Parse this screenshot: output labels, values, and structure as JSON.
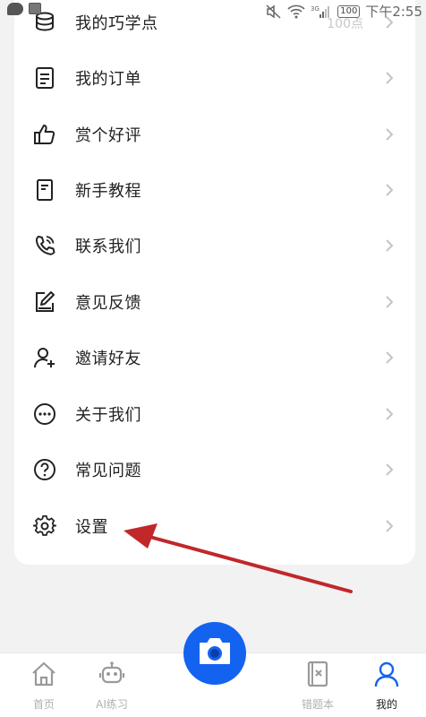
{
  "status_bar": {
    "time": "下午2:55",
    "battery": "100",
    "network": "3G"
  },
  "points": {
    "value": "100点"
  },
  "menu": {
    "items": [
      {
        "label": "我的巧学点",
        "icon": "coins-stack-icon"
      },
      {
        "label": "我的订单",
        "icon": "order-document-icon"
      },
      {
        "label": "赏个好评",
        "icon": "thumbs-up-icon"
      },
      {
        "label": "新手教程",
        "icon": "tutorial-book-icon"
      },
      {
        "label": "联系我们",
        "icon": "phone-icon"
      },
      {
        "label": "意见反馈",
        "icon": "feedback-edit-icon"
      },
      {
        "label": "邀请好友",
        "icon": "add-user-icon"
      },
      {
        "label": "关于我们",
        "icon": "more-dots-icon"
      },
      {
        "label": "常见问题",
        "icon": "question-circle-icon"
      },
      {
        "label": "设置",
        "icon": "gear-icon"
      }
    ]
  },
  "tab_bar": {
    "tabs": [
      {
        "label": "首页",
        "icon": "home-icon"
      },
      {
        "label": "AI练习",
        "icon": "robot-icon"
      },
      {
        "label": "错题本",
        "icon": "mistake-book-icon"
      },
      {
        "label": "我的",
        "icon": "profile-icon"
      }
    ],
    "active": "我的"
  },
  "colors": {
    "accent": "#1463f0",
    "annotation_arrow": "#c0282a",
    "inactive_tab": "#b0b0b0"
  }
}
